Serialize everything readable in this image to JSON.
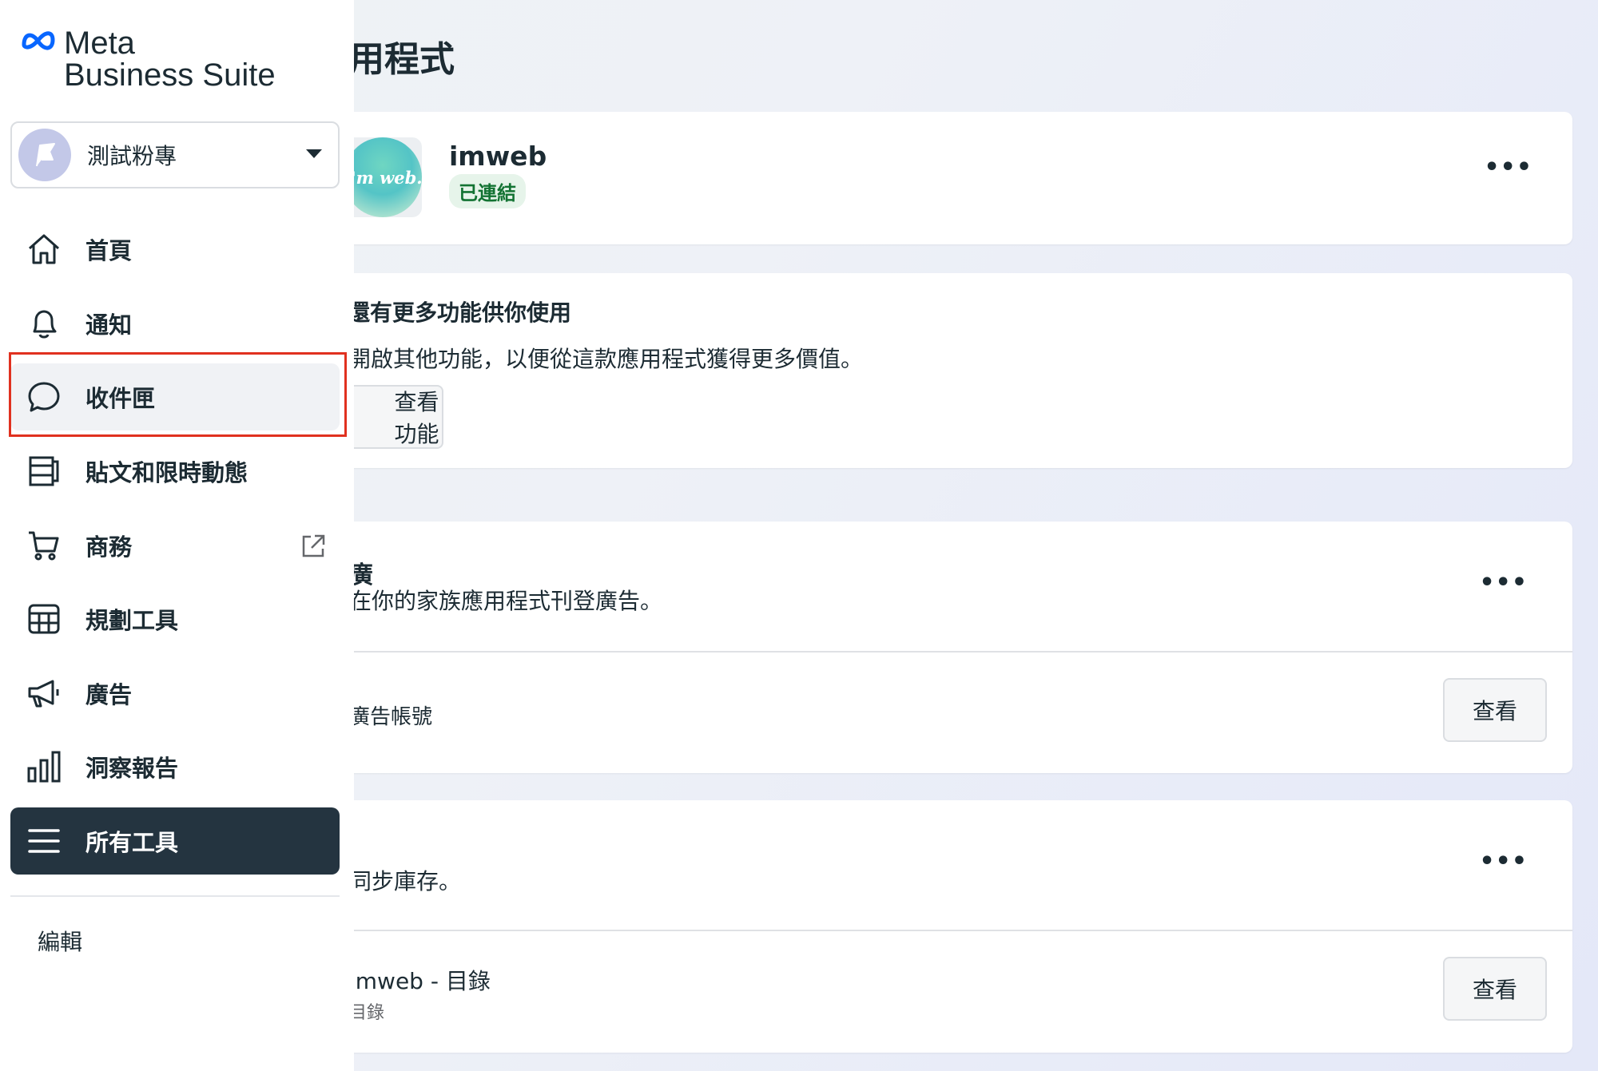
{
  "main": {
    "title": "應用程式",
    "app_card": {
      "logo_text": "I'm web.",
      "name": "imweb",
      "status": "已連結"
    },
    "promo_card": {
      "heading": "還有更多功能供你使用",
      "desc": "開啟其他功能，以便從這款應用程式獲得更多價值。",
      "button": "查看功能"
    },
    "ads_card": {
      "title_fragment": "廣",
      "desc": "在你的家族應用程式刊登廣告。",
      "row_label": "廣告帳號",
      "button": "查看"
    },
    "catalog_card": {
      "desc": "同步庫存。",
      "row_label": "imweb - 目錄",
      "row_sub": "目錄",
      "button": "查看"
    }
  },
  "sidebar": {
    "brand_line1": "Meta",
    "brand_line2": "Business Suite",
    "page_selector": {
      "name": "測試粉專"
    },
    "items": [
      {
        "label": "首頁",
        "icon": "home-icon"
      },
      {
        "label": "通知",
        "icon": "bell-icon"
      },
      {
        "label": "收件匣",
        "icon": "chat-bubble-icon"
      },
      {
        "label": "貼文和限時動態",
        "icon": "posts-icon"
      },
      {
        "label": "商務",
        "icon": "cart-icon"
      },
      {
        "label": "規劃工具",
        "icon": "calendar-grid-icon"
      },
      {
        "label": "廣告",
        "icon": "megaphone-icon"
      },
      {
        "label": "洞察報告",
        "icon": "bar-chart-icon"
      },
      {
        "label": "所有工具",
        "icon": "menu-icon"
      }
    ],
    "edit_label": "編輯"
  },
  "colors": {
    "active_bg": "#243440",
    "highlight": "#e0311f",
    "status_green": "#137333"
  }
}
